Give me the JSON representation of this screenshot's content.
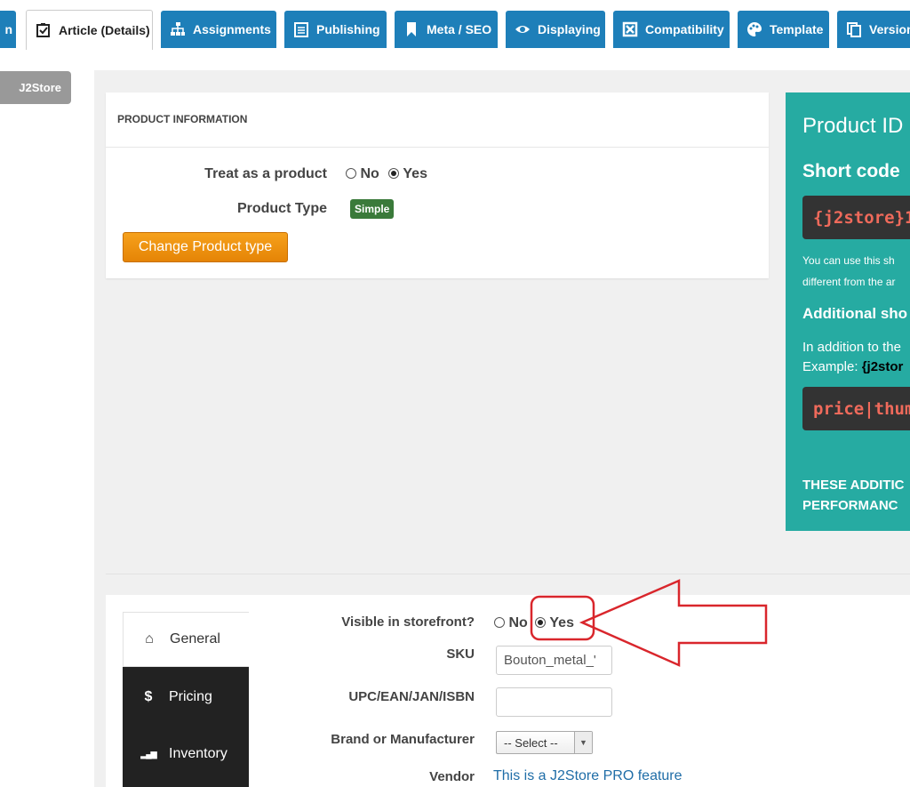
{
  "tabs": [
    {
      "label": "n",
      "icon": "fragment-icon"
    },
    {
      "label": "Article (Details)",
      "icon": "checkbox-icon",
      "active": true
    },
    {
      "label": "Assignments",
      "icon": "sitemap-icon"
    },
    {
      "label": "Publishing",
      "icon": "calendar-icon"
    },
    {
      "label": "Meta / SEO",
      "icon": "bookmark-icon"
    },
    {
      "label": "Displaying",
      "icon": "eye-icon"
    },
    {
      "label": "Compatibility",
      "icon": "puzzle-icon"
    },
    {
      "label": "Template",
      "icon": "palette-icon"
    },
    {
      "label": "Version",
      "icon": "copy-icon"
    }
  ],
  "sidebar": {
    "j2store_label": "J2Store"
  },
  "product_info": {
    "title": "PRODUCT INFORMATION",
    "treat_label": "Treat as a product",
    "treat_options": [
      "No",
      "Yes"
    ],
    "treat_value": "Yes",
    "type_label": "Product Type",
    "type_value": "Simple",
    "change_button": "Change Product type"
  },
  "teal_panel": {
    "product_id_heading": "Product ID",
    "short_code_heading": "Short code",
    "short_code": "{j2store}1",
    "help_line_1": "You can use this sh",
    "help_line_2": "different from the ar",
    "additional_heading": "Additional sho",
    "addition_line_1": "In addition to the",
    "addition_example_label": "Example:",
    "addition_example_code": "{j2stor",
    "additional_code": "price|thum",
    "caps_line_1": "THESE ADDITIC",
    "caps_line_2": "PERFORMANC"
  },
  "lower": {
    "side_tabs": [
      {
        "label": "General",
        "icon": "home-icon",
        "glyph": "⌂",
        "active": true
      },
      {
        "label": "Pricing",
        "icon": "dollar-icon",
        "glyph": "$"
      },
      {
        "label": "Inventory",
        "icon": "signal-bars-icon",
        "glyph": "▂▄▆"
      }
    ],
    "visible_label": "Visible in storefront?",
    "visible_options": [
      "No",
      "Yes"
    ],
    "visible_value": "Yes",
    "sku_label": "SKU",
    "sku_value": "Bouton_metal_'",
    "upc_label": "UPC/EAN/JAN/ISBN",
    "upc_value": "",
    "brand_label": "Brand or Manufacturer",
    "brand_value": "-- Select --",
    "vendor_label": "Vendor",
    "vendor_value": "This is a J2Store PRO feature"
  },
  "colors": {
    "tab_blue": "#1e7fb9",
    "teal": "#26aba2",
    "orange": "#e58406",
    "badge_green": "#3a7a3a",
    "annotation_red": "#d9262c"
  }
}
